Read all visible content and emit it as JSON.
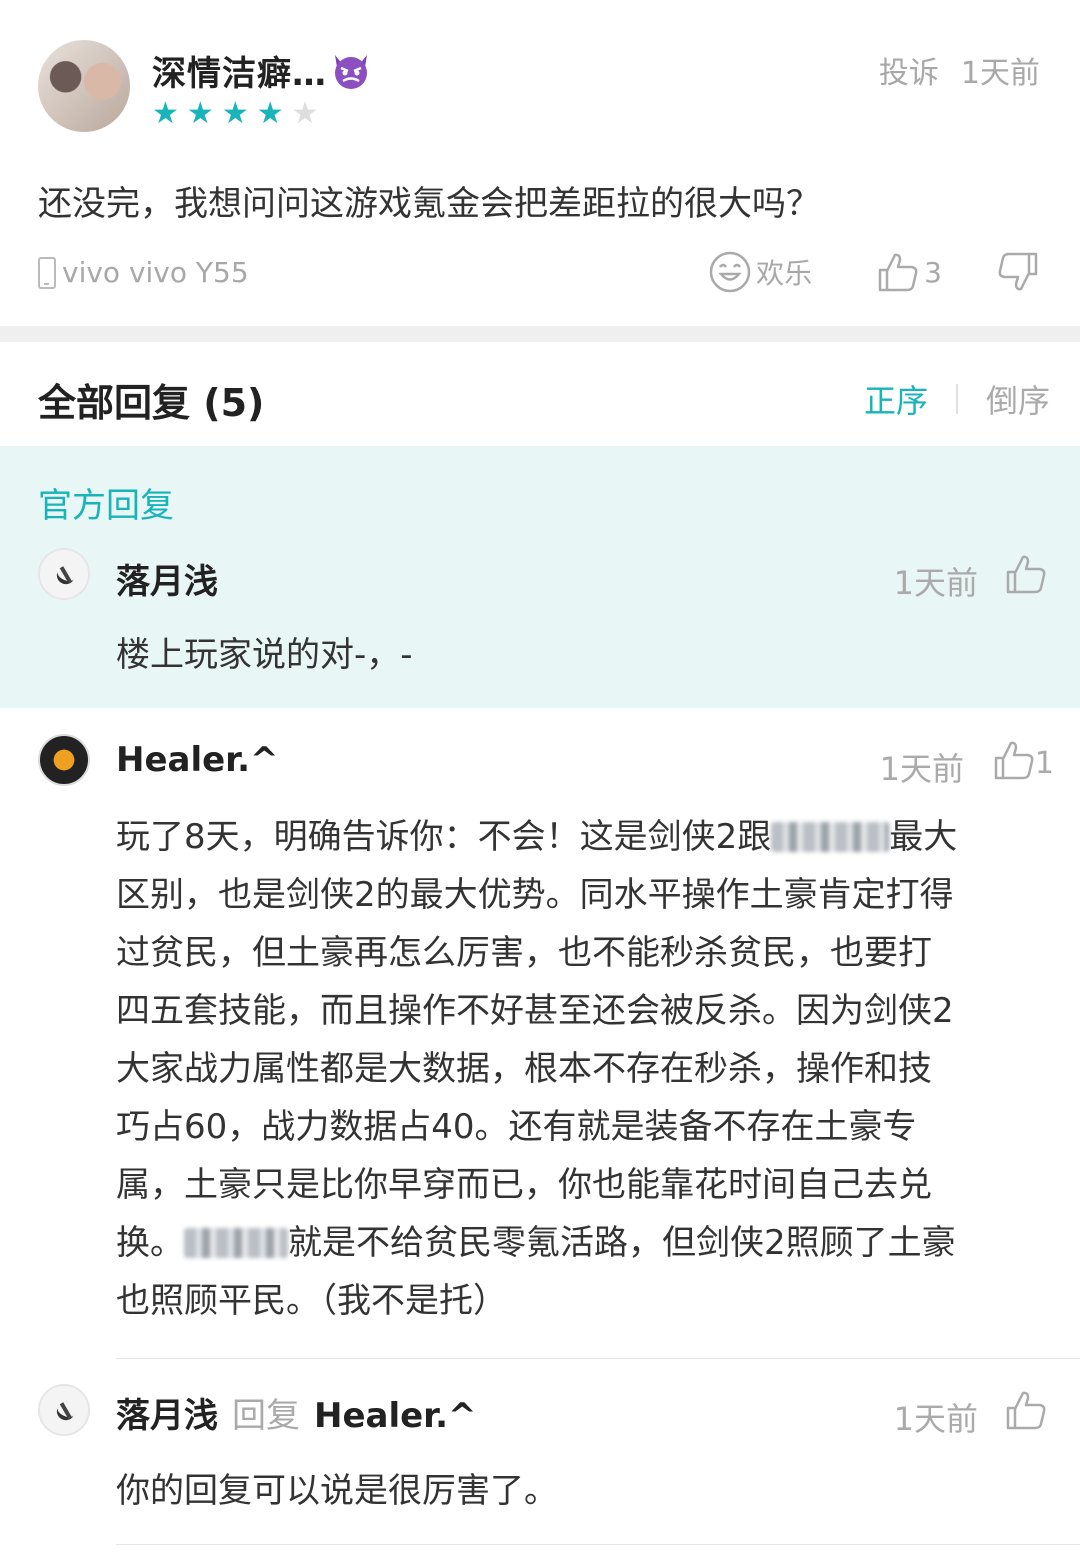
{
  "post": {
    "username": "深情洁癖…",
    "rating": 4,
    "rating_max": 5,
    "report_label": "投诉",
    "time": "1天前",
    "text": "还没完，我想问问这游戏氪金会把差距拉的很大吗？",
    "device": "vivo vivo Y55",
    "fun_label": "欢乐",
    "like_count": "3"
  },
  "replies_header": {
    "title": "全部回复 (5)",
    "sort_asc": "正序",
    "sort_desc": "倒序"
  },
  "official": {
    "label": "官方回复",
    "name": "落月浅",
    "time": "1天前",
    "text": "楼上玩家说的对-，-"
  },
  "reply1": {
    "name": "Healer.^",
    "time": "1天前",
    "like_count": "1",
    "lines": [
      "玩了8天，明确告诉你：不会！这是剑侠2跟",
      "最大",
      "区别，也是剑侠2的最大优势。同水平操作土豪肯定打得",
      "过贫民，但土豪再怎么厉害，也不能秒杀贫民，也要打",
      "四五套技能，而且操作不好甚至还会被反杀。因为剑侠2",
      "大家战力属性都是大数据，根本不存在秒杀，操作和技",
      "巧占60，战力数据占40。还有就是装备不存在土豪专",
      "属，土豪只是比你早穿而已，你也能靠花时间自己去兑",
      "换。",
      "就是不给贫民零氪活路，但剑侠2照顾了土豪",
      "也照顾平民。（我不是托）"
    ]
  },
  "reply2": {
    "name": "落月浅",
    "reply_word": "回复",
    "target": "Healer.^",
    "time": "1天前",
    "text": "你的回复可以说是很厉害了。"
  },
  "colors": {
    "accent": "#18b4b9",
    "official_bg": "#e9f6f6",
    "muted": "#aaaaaa"
  }
}
